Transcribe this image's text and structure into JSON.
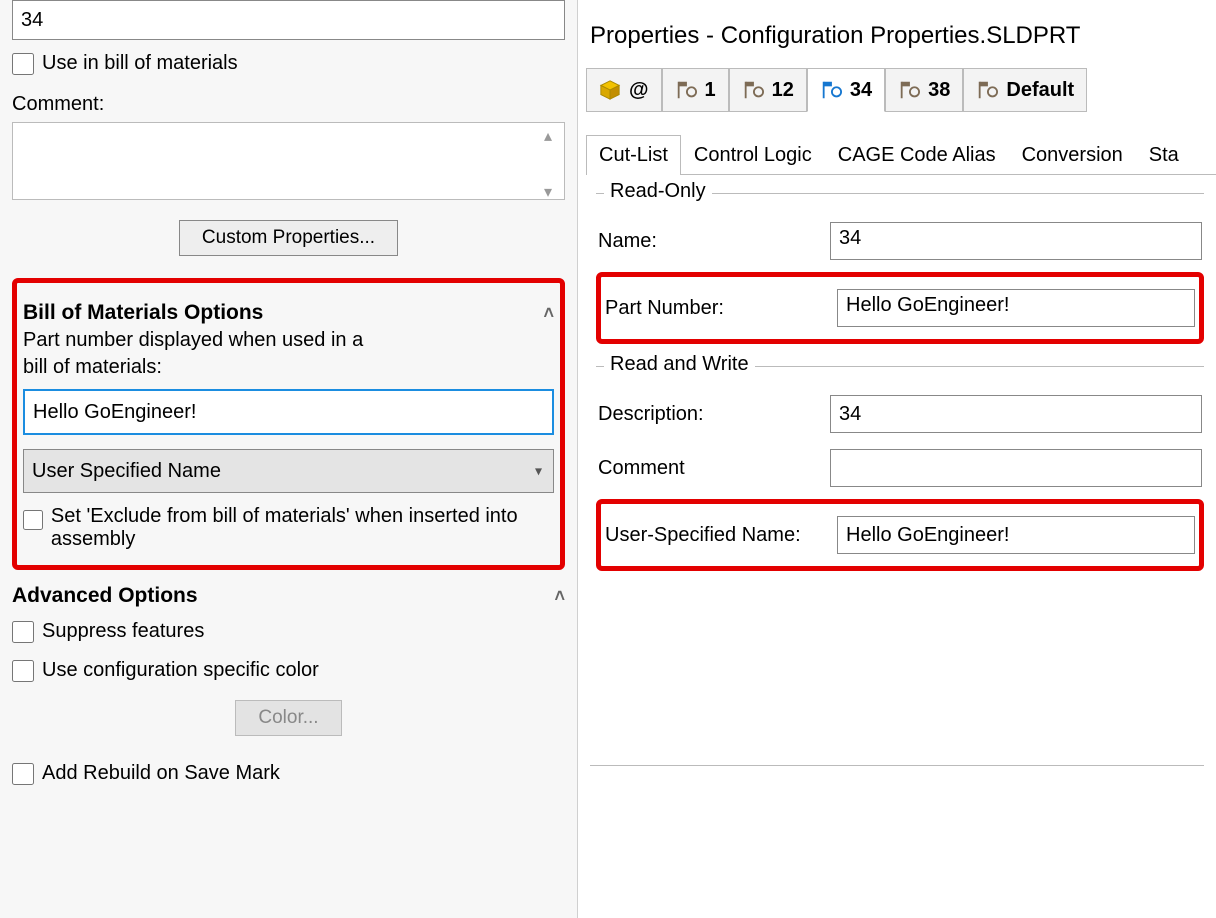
{
  "left": {
    "top_value": "34",
    "use_in_bom_label": "Use in bill of materials",
    "comment_label": "Comment:",
    "comment_value": "",
    "custom_props_btn": "Custom Properties...",
    "bom_section": {
      "title": "Bill of Materials Options",
      "description_line1": "Part number displayed when used in a",
      "description_line2": "bill of materials:",
      "part_number_value": "Hello GoEngineer!",
      "name_mode": "User Specified Name",
      "exclude_label": "Set 'Exclude from bill of materials' when inserted into assembly"
    },
    "adv_section": {
      "title": "Advanced Options",
      "suppress_label": "Suppress features",
      "config_color_label": "Use configuration specific color",
      "color_btn": "Color...",
      "add_rebuild_label": "Add Rebuild on Save Mark"
    }
  },
  "right": {
    "title": "Properties - Configuration Properties.SLDPRT",
    "config_tabs": [
      {
        "label": "@",
        "icon": "cube"
      },
      {
        "label": "1",
        "icon": "flag"
      },
      {
        "label": "12",
        "icon": "flag"
      },
      {
        "label": "34",
        "icon": "flagA",
        "active": true
      },
      {
        "label": "38",
        "icon": "flag"
      },
      {
        "label": "Default",
        "icon": "flag"
      }
    ],
    "sec_tabs": [
      {
        "label": "Cut-List",
        "active": true
      },
      {
        "label": "Control Logic"
      },
      {
        "label": "CAGE Code Alias"
      },
      {
        "label": "Conversion"
      },
      {
        "label": "Sta"
      }
    ],
    "readonly": {
      "title": "Read-Only",
      "name_label": "Name:",
      "name_value": "34",
      "partnum_label": "Part Number:",
      "partnum_value": "Hello GoEngineer!"
    },
    "readwrite": {
      "title": "Read and Write",
      "desc_label": "Description:",
      "desc_value": "34",
      "comment_label": "Comment",
      "comment_value": "",
      "usn_label": "User-Specified Name:",
      "usn_value": "Hello GoEngineer!"
    }
  }
}
